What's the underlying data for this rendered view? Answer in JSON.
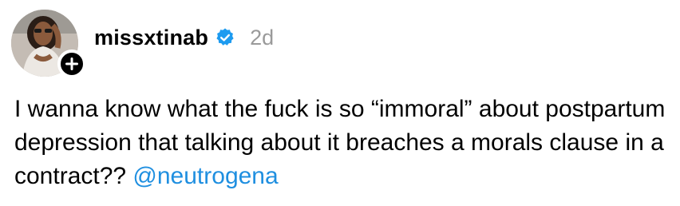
{
  "post": {
    "author": {
      "username": "missxtinab",
      "verified": true,
      "avatar_icon": "profile-photo",
      "follow_icon": "plus-icon"
    },
    "timestamp": "2d",
    "body": {
      "text": "I wanna know what the fuck is so “immoral” about postpartum depression that talking about it breaches a morals clause in a contract?? ",
      "mention": "@neutrogena"
    }
  },
  "colors": {
    "mention": "#1f8fe0",
    "verified_badge": "#1d9bf0",
    "timestamp": "#9a9a9a"
  }
}
